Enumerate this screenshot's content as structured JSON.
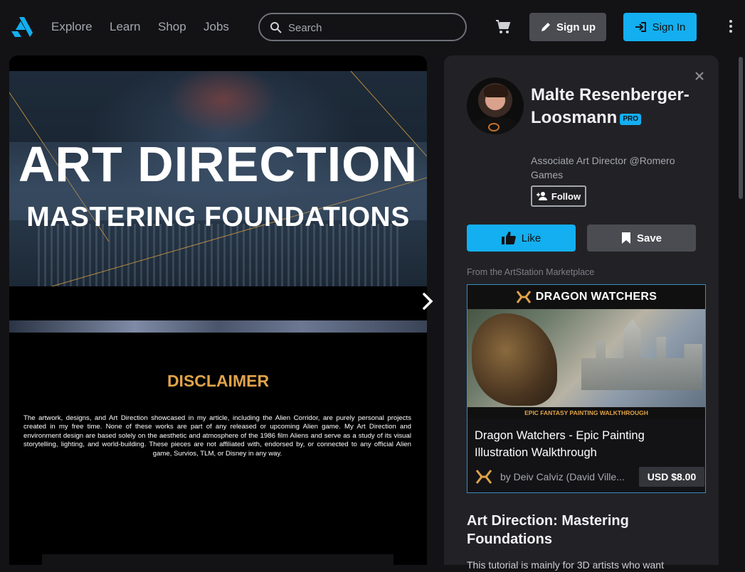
{
  "header": {
    "nav": [
      {
        "label": "Explore"
      },
      {
        "label": "Learn"
      },
      {
        "label": "Shop"
      },
      {
        "label": "Jobs"
      }
    ],
    "search": {
      "placeholder": "Search",
      "value": ""
    },
    "signup_label": "Sign up",
    "signin_label": "Sign In",
    "accent_color": "#13aff0"
  },
  "artwork": {
    "hero_title": "ART DIRECTION",
    "hero_subtitle": "MASTERING FOUNDATIONS",
    "disclaimer_title": "DISCLAIMER",
    "disclaimer_text": "The artwork, designs, and Art Direction showcased in my article, including the Alien Corridor, are purely personal projects created in my free time. None of these works are part of any released or upcoming Alien game. My Art Direction and environment design are based solely on the aesthetic and atmosphere of the 1986 film Aliens and serve as a study of its visual storytelling, lighting, and world-building. These pieces are not affiliated with, endorsed by, or connected to any official Alien game, Survios, TLM, or Disney in any way."
  },
  "profile": {
    "name": "Malte Resenberger-Loosmann",
    "badge": "PRO",
    "job_title": "Associate Art Director @Romero Games",
    "follow_label": "Follow"
  },
  "actions": {
    "like_label": "Like",
    "save_label": "Save"
  },
  "marketplace": {
    "label": "From the ArtStation Marketplace",
    "banner_title": "DRAGON WATCHERS",
    "banner_caption": "EPIC FANTASY PAINTING WALKTHROUGH",
    "title": "Dragon Watchers - Epic Painting Illustration Walkthrough",
    "author": "by Deiv Calviz (David Ville...",
    "price": "USD $8.00"
  },
  "article": {
    "title": "Art Direction: Mastering Foundations",
    "intro": "This tutorial is mainly for 3D artists who want"
  }
}
